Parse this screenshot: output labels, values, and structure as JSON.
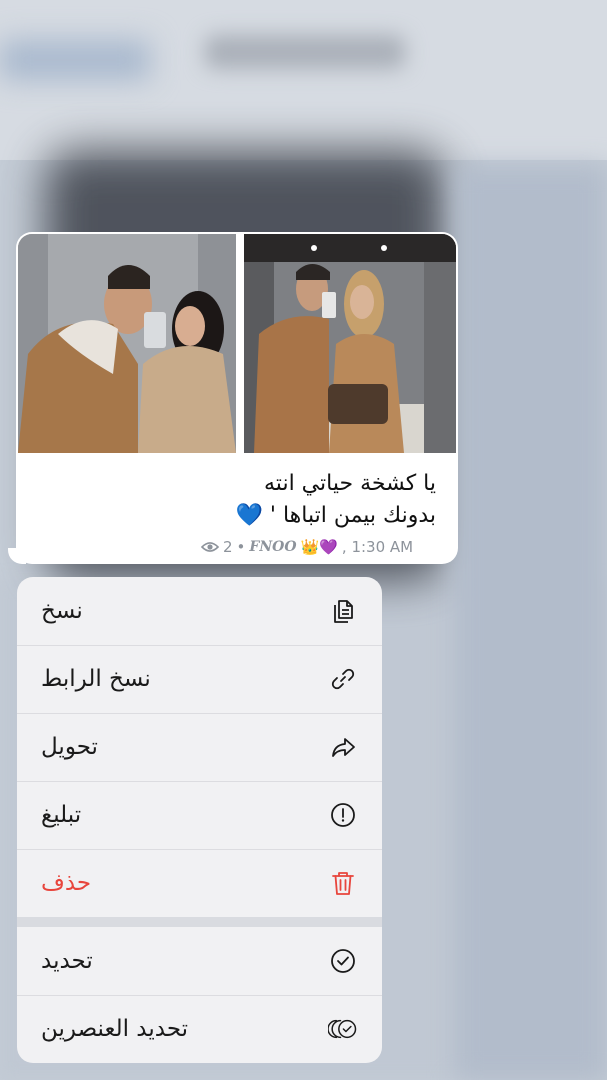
{
  "message": {
    "text_line1": "يا كشخة حياتي انته",
    "text_line2": "بدونك بيمن اتباها ' 💙",
    "views": "2",
    "signature": "FNOO",
    "signature_emojis": "👑💜",
    "time": ", 1:30 AM"
  },
  "menu": {
    "items": [
      {
        "label": "نسخ",
        "icon": "copy-icon"
      },
      {
        "label": "نسخ الرابط",
        "icon": "link-icon"
      },
      {
        "label": "تحويل",
        "icon": "forward-icon"
      },
      {
        "label": "تبليغ",
        "icon": "report-icon"
      },
      {
        "label": "حذف",
        "icon": "trash-icon",
        "color": "#e8453c"
      },
      {
        "label": "تحديد",
        "icon": "select-check-icon"
      },
      {
        "label": "تحديد العنصرين",
        "icon": "select-multiple-icon"
      }
    ]
  },
  "colors": {
    "danger": "#e8453c",
    "menu_bg": "#f1f1f3",
    "bubble_bg": "#ffffff"
  }
}
